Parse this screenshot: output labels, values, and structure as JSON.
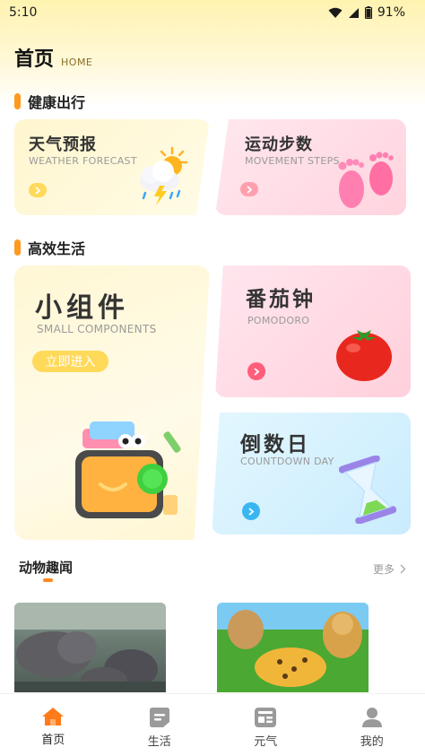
{
  "status_bar": {
    "time": "5:10",
    "battery": "91%"
  },
  "header": {
    "title": "首页",
    "subtitle": "HOME"
  },
  "sections": {
    "health": {
      "title": "健康出行"
    },
    "efficiency": {
      "title": "高效生活"
    }
  },
  "cards": {
    "weather": {
      "title": "天气预报",
      "subtitle": "WEATHER FORECAST",
      "icon": "weather-sun-cloud-icon"
    },
    "steps": {
      "title": "运动步数",
      "subtitle": "MOVEMENT STEPS",
      "icon": "footprints-icon"
    },
    "widgets": {
      "title": "小组件",
      "subtitle": "SMALL COMPONENTS",
      "button": "立即进入",
      "icon": "widget-tablet-icon"
    },
    "pomodoro": {
      "title": "番茄钟",
      "subtitle": "POMODORO",
      "icon": "tomato-icon"
    },
    "countdown": {
      "title": "倒数日",
      "subtitle": "COUNTDOWN DAY",
      "icon": "hourglass-icon"
    }
  },
  "news": {
    "title": "动物趣闻",
    "more": "更多"
  },
  "tabs": [
    {
      "label": "首页",
      "icon": "home-icon",
      "active": true
    },
    {
      "label": "生活",
      "icon": "life-icon",
      "active": false
    },
    {
      "label": "元气",
      "icon": "news-icon",
      "active": false
    },
    {
      "label": "我的",
      "icon": "profile-icon",
      "active": false
    }
  ],
  "colors": {
    "accent": "#ff9a1f",
    "tab_active": "#ff7a1a",
    "tab_inactive": "#9a9a9a"
  }
}
